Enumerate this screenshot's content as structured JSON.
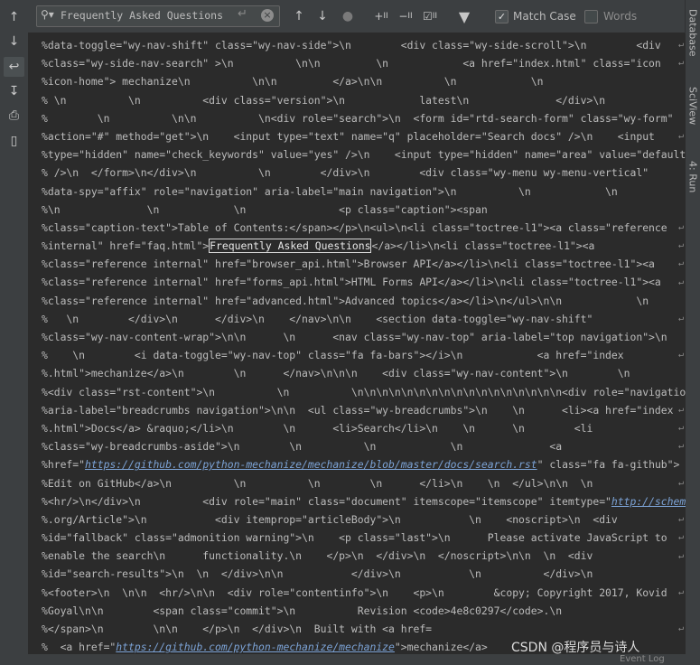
{
  "search": {
    "query": "Frequently Asked Questions",
    "match_case_label": "Match Case",
    "match_case_checked": true,
    "words_label": "Words",
    "words_checked": false
  },
  "toolbar_icons": [
    "arrow-up-icon",
    "arrow-down-icon",
    "find-usages-icon",
    "add-selection-icon",
    "remove-selection-icon",
    "select-all-occurrences-icon",
    "filter-icon"
  ],
  "right_tabs": [
    "Database",
    "SciView",
    "4: Run"
  ],
  "code_lines": [
    "%data-toggle=\"wy-nav-shift\" class=\"wy-nav-side\">\\n        <div class=\"wy-side-scroll\">\\n        <div",
    "%class=\"wy-side-nav-search\" >\\n          \\n\\n         \\n            <a href=\"index.html\" class=\"icon",
    "%icon-home\"> mechanize\\n          \\n\\n         </a>\\n\\n          \\n            \\n",
    "% \\n          \\n          <div class=\"version\">\\n            latest\\n              </div>\\n",
    "%        \\n          \\n\\n          \\n<div role=\"search\">\\n  <form id=\"rtd-search-form\" class=\"wy-form\"",
    "%action=\"#\" method=\"get\">\\n    <input type=\"text\" name=\"q\" placeholder=\"Search docs\" />\\n    <input",
    "%type=\"hidden\" name=\"check_keywords\" value=\"yes\" />\\n    <input type=\"hidden\" name=\"area\" value=\"default\"",
    "% />\\n  </form>\\n</div>\\n          \\n        </div>\\n        <div class=\"wy-menu wy-menu-vertical\"",
    "%data-spy=\"affix\" role=\"navigation\" aria-label=\"main navigation\">\\n          \\n            \\n",
    "%\\n              \\n            \\n               <p class=\"caption\"><span",
    "%class=\"caption-text\">Table of Contents:</span></p>\\n<ul>\\n<li class=\"toctree-l1\"><a class=\"reference",
    "%internal\" href=\"faq.html\">Frequently Asked Questions</a></li>\\n<li class=\"toctree-l1\"><a",
    "%class=\"reference internal\" href=\"browser_api.html\">Browser API</a></li>\\n<li class=\"toctree-l1\"><a",
    "%class=\"reference internal\" href=\"forms_api.html\">HTML Forms API</a></li>\\n<li class=\"toctree-l1\"><a",
    "%class=\"reference internal\" href=\"advanced.html\">Advanced topics</a></li>\\n</ul>\\n\\n            \\n",
    "%   \\n        </div>\\n      </div>\\n    </nav>\\n\\n    <section data-toggle=\"wy-nav-shift\"",
    "%class=\"wy-nav-content-wrap\">\\n\\n      \\n      <nav class=\"wy-nav-top\" aria-label=\"top navigation\">\\n",
    "%    \\n        <i data-toggle=\"wy-nav-top\" class=\"fa fa-bars\"></i>\\n            <a href=\"index",
    "%.html\">mechanize</a>\\n        \\n      </nav>\\n\\n\\n    <div class=\"wy-nav-content\">\\n        \\n",
    "%<div class=\"rst-content\">\\n          \\n          \\n\\n\\n\\n\\n\\n\\n\\n\\n\\n\\n\\n\\n\\n\\n\\n\\n<div role=\"navigation\"",
    "%aria-label=\"breadcrumbs navigation\">\\n\\n  <ul class=\"wy-breadcrumbs\">\\n    \\n      <li><a href=\"index",
    "%.html\">Docs</a> &raquo;</li>\\n        \\n      <li>Search</li>\\n    \\n      \\n        <li",
    "%class=\"wy-breadcrumbs-aside\">\\n        \\n          \\n            \\n              <a",
    "%href=\"https://github.com/python-mechanize/mechanize/blob/master/docs/search.rst\" class=\"fa fa-github\">",
    "%Edit on GitHub</a>\\n          \\n          \\n        \\n      </li>\\n    \\n  </ul>\\n\\n  \\n",
    "%<hr/>\\n</div>\\n          <div role=\"main\" class=\"document\" itemscope=\"itemscope\" itemtype=\"http://schema",
    "%.org/Article\">\\n           <div itemprop=\"articleBody\">\\n           \\n    <noscript>\\n  <div",
    "%id=\"fallback\" class=\"admonition warning\">\\n    <p class=\"last\">\\n      Please activate JavaScript to",
    "%enable the search\\n      functionality.\\n    </p>\\n  </div>\\n  </noscript>\\n\\n  \\n  <div",
    "%id=\"search-results\">\\n  \\n  </div>\\n\\n           </div>\\n           \\n          </div>\\n",
    "%<footer>\\n  \\n\\n  <hr/>\\n\\n  <div role=\"contentinfo\">\\n    <p>\\n        &copy; Copyright 2017, Kovid",
    "%Goyal\\n\\n        <span class=\"commit\">\\n          Revision <code>4e8c0297</code>.\\n",
    "%</span>\\n        \\n\\n    </p>\\n  </div>\\n  Built with <a href=",
    "%  <a href=\"https://github.com/python-mechanize/mechanize\">mechanize</a>"
  ],
  "watermark": "CSDN @程序员与诗人",
  "status": {
    "event_log": "Event Log"
  }
}
